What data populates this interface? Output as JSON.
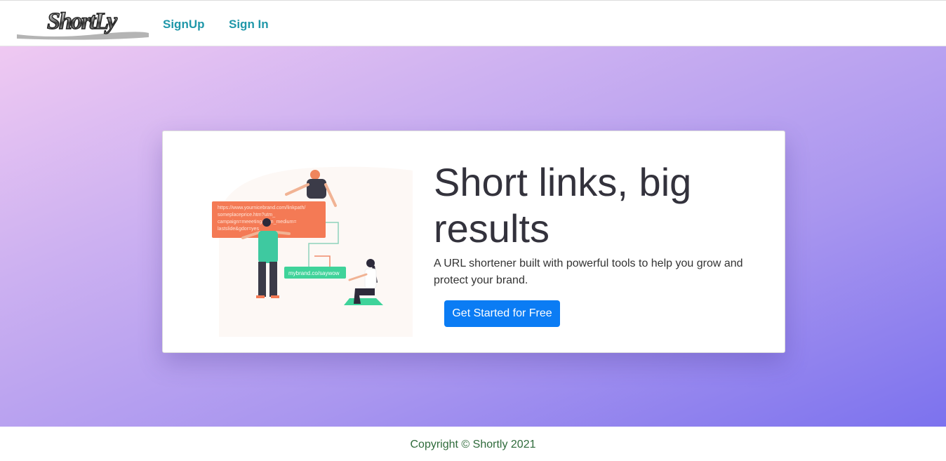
{
  "navbar": {
    "logo_text": "ShortLy",
    "links": [
      {
        "label": "SignUp"
      },
      {
        "label": "Sign In"
      }
    ]
  },
  "hero": {
    "headline": "Short links, big results",
    "subtext": "A URL shortener built with powerful tools to help you grow and protect your brand.",
    "cta_label": "Get Started for Free",
    "illustration": {
      "long_url_lines": [
        "https://www.yournicebrand.com/linkpath/",
        "someplaceprice.htm?utm_",
        "campaign=meeeting&utm_medium=",
        "lastslide&gdor=yes"
      ],
      "short_url": "mybrand.co/saywow"
    }
  },
  "footer": {
    "copyright": "Copyright © Shortly 2021"
  },
  "colors": {
    "nav_link": "#1f97a9",
    "cta": "#0b7cf4",
    "gradient_start": "#efc9f2",
    "gradient_end": "#7c72ee",
    "footer_text": "#2f6b3b"
  }
}
